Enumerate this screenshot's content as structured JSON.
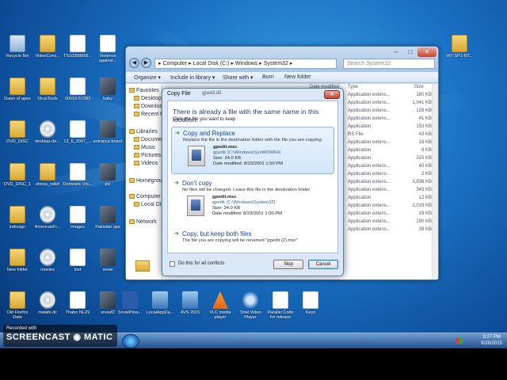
{
  "desktop": {
    "icons": [
      {
        "label": "Recycle Bin",
        "type": "bin",
        "col": 0,
        "row": 0
      },
      {
        "label": "VideoConv...",
        "type": "folder",
        "col": 1,
        "row": 0
      },
      {
        "label": "TS10398856...",
        "type": "file",
        "col": 2,
        "row": 0
      },
      {
        "label": "Violence against...",
        "type": "file",
        "col": 3,
        "row": 0
      },
      {
        "label": "Dawn of apes",
        "type": "folder",
        "col": 0,
        "row": 1
      },
      {
        "label": "VirusTools",
        "type": "folder",
        "col": 1,
        "row": 1
      },
      {
        "label": "00010-57283",
        "type": "file",
        "col": 2,
        "row": 1
      },
      {
        "label": "baby",
        "type": "photo",
        "col": 3,
        "row": 1
      },
      {
        "label": "DVD_DISC",
        "type": "folder",
        "col": 0,
        "row": 2
      },
      {
        "label": "desktop-de...",
        "type": "disc",
        "col": 1,
        "row": 2
      },
      {
        "label": "13_6_2007_...",
        "type": "file",
        "col": 2,
        "row": 2
      },
      {
        "label": "entrance board",
        "type": "photo",
        "col": 3,
        "row": 2
      },
      {
        "label": "DVD_DISC_1",
        "type": "folder",
        "col": 0,
        "row": 3
      },
      {
        "label": "stress_relief",
        "type": "folder",
        "col": 1,
        "row": 3
      },
      {
        "label": "Domestic Vio...",
        "type": "file",
        "col": 2,
        "row": 3
      },
      {
        "label": "pic",
        "type": "photo",
        "col": 3,
        "row": 3
      },
      {
        "label": "indesign",
        "type": "folder",
        "col": 0,
        "row": 4
      },
      {
        "label": "AmericanFi...",
        "type": "disc",
        "col": 1,
        "row": 4
      },
      {
        "label": "images",
        "type": "file",
        "col": 2,
        "row": 4
      },
      {
        "label": "Pakistan ops",
        "type": "photo",
        "col": 3,
        "row": 4
      },
      {
        "label": "New folder",
        "type": "folder",
        "col": 0,
        "row": 5
      },
      {
        "label": "movies",
        "type": "disc",
        "col": 1,
        "row": 5
      },
      {
        "label": "lost",
        "type": "file",
        "col": 2,
        "row": 5
      },
      {
        "label": "snow",
        "type": "photo",
        "col": 3,
        "row": 5
      },
      {
        "label": "Old Firefox Data",
        "type": "folder",
        "col": 0,
        "row": 6
      },
      {
        "label": "malafe.dc",
        "type": "disc",
        "col": 1,
        "row": 6
      },
      {
        "label": "Thabo NLZ9",
        "type": "file",
        "col": 2,
        "row": 6
      },
      {
        "label": "snowf2",
        "type": "photo",
        "col": 3,
        "row": 6
      },
      {
        "label": "SnowPlow...",
        "type": "word",
        "col": 4,
        "row": 6
      },
      {
        "label": "LocalAppDa...",
        "type": "app",
        "col": 5,
        "row": 6
      },
      {
        "label": "AVS 2015",
        "type": "app",
        "col": 6,
        "row": 6
      },
      {
        "label": "VLC media player",
        "type": "cone",
        "col": 7,
        "row": 6
      },
      {
        "label": "Total Video Player",
        "type": "media",
        "col": 8,
        "row": 6
      },
      {
        "label": "Parallel Code for release",
        "type": "file",
        "col": 9,
        "row": 6
      },
      {
        "label": "Keys",
        "type": "file",
        "col": 10,
        "row": 6
      },
      {
        "label": "W7-SP1-RT...",
        "type": "folder",
        "col": 14,
        "row": 0
      }
    ]
  },
  "explorer": {
    "address": "▸ Computer ▸ Local Disk (C:) ▸ Windows ▸ System32 ▸",
    "search_placeholder": "Search System32",
    "toolbar": [
      "Organize ▾",
      "Include in library ▾",
      "Share with ▾",
      "Burn",
      "New folder"
    ],
    "columns": {
      "date": "Date modified",
      "type": "Type",
      "size": "Size"
    },
    "nav_items": [
      "Favorites",
      "Desktop",
      "Downloads",
      "Recent Places",
      "Libraries",
      "Documents",
      "Music",
      "Pictures",
      "Videos",
      "Homegroup",
      "Computer",
      "Local Disk (C:)",
      "Network"
    ],
    "rows": [
      {
        "type": "Application extens...",
        "size": "180 KB"
      },
      {
        "type": "Application extens...",
        "size": "1,041 KB"
      },
      {
        "type": "Application extens...",
        "size": "128 KB"
      },
      {
        "type": "Application extens...",
        "size": "41 KB"
      },
      {
        "type": "Application",
        "size": "153 KB"
      },
      {
        "type": "RS File",
        "size": "43 KB"
      },
      {
        "type": "Application extens...",
        "size": "18 KB"
      },
      {
        "type": "Application",
        "size": "8 KB"
      },
      {
        "type": "Application",
        "size": "315 KB"
      },
      {
        "type": "Application extens...",
        "size": "40 KB"
      },
      {
        "type": "Application extens...",
        "size": "2 KB"
      },
      {
        "type": "Application extens...",
        "size": "3,836 KB"
      },
      {
        "type": "Application extens...",
        "size": "343 KB"
      },
      {
        "type": "Application",
        "size": "12 KB"
      },
      {
        "type": "Application extens...",
        "size": "2,019 KB"
      },
      {
        "type": "Application extens...",
        "size": "19 KB"
      },
      {
        "type": "Application extens...",
        "size": "190 KB"
      },
      {
        "type": "Application extens...",
        "size": "39 KB"
      }
    ]
  },
  "dialog": {
    "title": "Copy File",
    "behind_title": "gpedit.dll",
    "heading": "There is already a file with the same name in this location.",
    "subheading": "Click the file you want to keep",
    "options": [
      {
        "title": "Copy and Replace",
        "desc": "Replace the file in the destination folder with the file you are copying:",
        "file": {
          "name": "gpedit.msc",
          "path": "gpedit (C:\\Windows\\SysWOW64)",
          "size": "Size: 34.0 KB",
          "date": "Date modified: 8/23/2001 1:00 PM"
        }
      },
      {
        "title": "Don't copy",
        "desc": "No files will be changed. Leave this file in the destination folder:",
        "file": {
          "name": "gpedit.msc",
          "path": "gpedit (C:\\Windows\\System32)",
          "size": "Size: 34.0 KB",
          "date": "Date modified: 8/23/2001 1:00 PM"
        }
      },
      {
        "title": "Copy, but keep both files",
        "desc": "The file you are copying will be renamed \"gpedit (2).msc\""
      }
    ],
    "checkbox_label": "Do this for all conflicts",
    "skip_label": "Skip",
    "cancel_label": "Cancel"
  },
  "taskbar": {
    "time": "9:27 PM",
    "date": "6/28/2015"
  },
  "watermark": {
    "recorded": "Recorded with",
    "logo": "SCREENCAST ◉ MATIC"
  }
}
